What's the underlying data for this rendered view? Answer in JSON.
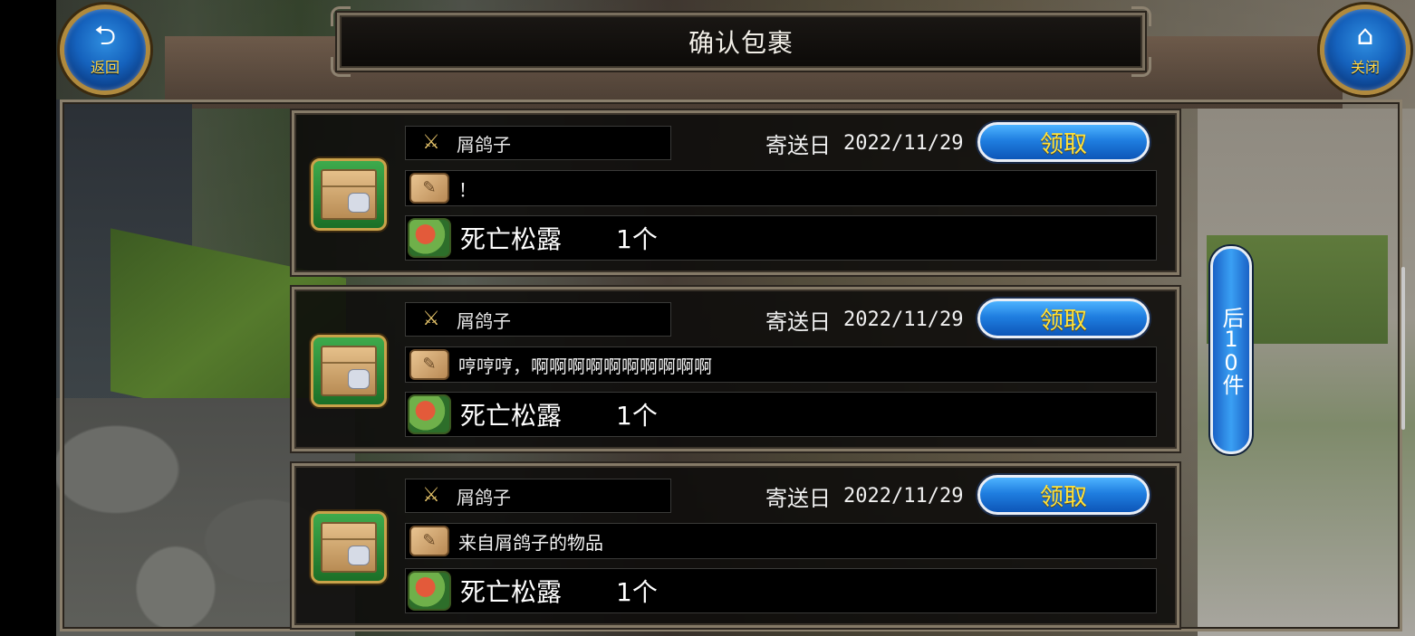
{
  "header": {
    "title": "确认包裹",
    "back_label": "返回",
    "close_label": "关闭"
  },
  "parcels": [
    {
      "sender": "屑鸽子",
      "date_label": "寄送日",
      "date": "2022/11/29",
      "claim_label": "领取",
      "message": "！",
      "item_name": "死亡松露",
      "item_qty": "1个"
    },
    {
      "sender": "屑鸽子",
      "date_label": "寄送日",
      "date": "2022/11/29",
      "claim_label": "领取",
      "message": "哼哼哼，啊啊啊啊啊啊啊啊啊啊",
      "item_name": "死亡松露",
      "item_qty": "1个"
    },
    {
      "sender": "屑鸽子",
      "date_label": "寄送日",
      "date": "2022/11/29",
      "claim_label": "领取",
      "message": "来自屑鸽子的物品",
      "item_name": "死亡松露",
      "item_qty": "1个"
    }
  ],
  "pager": {
    "next_label": "后10件"
  },
  "icons": {
    "back": "back-arrow-icon",
    "close": "home-icon",
    "sender": "guild-emblem-icon",
    "message": "scroll-quill-icon",
    "item": "truffle-item-icon",
    "parcel": "parcel-box-icon"
  },
  "colors": {
    "claim_button": "#1f7ee0",
    "claim_text": "#ffe23a",
    "round_button": "#1562bd",
    "panel_border": "#857a67"
  }
}
